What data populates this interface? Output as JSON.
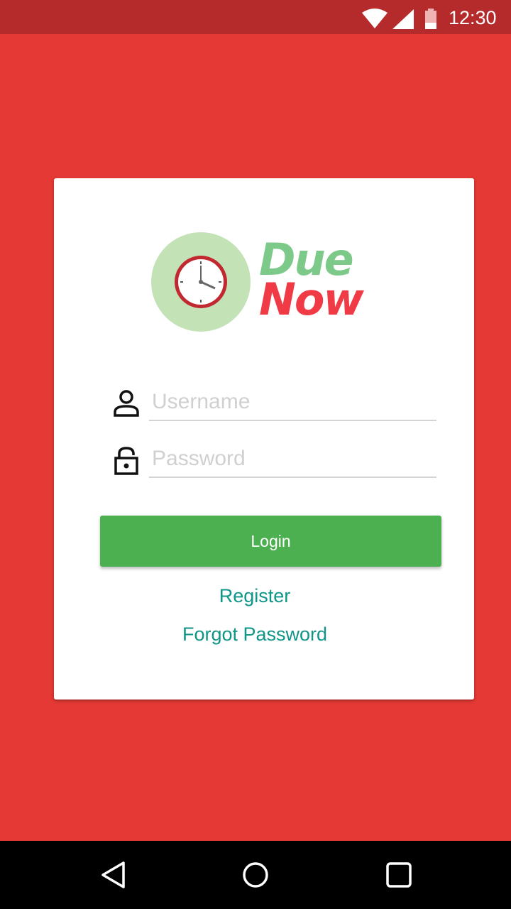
{
  "status_bar": {
    "time": "12:30",
    "icons": [
      "wifi-icon",
      "cell-signal-icon",
      "battery-low-icon"
    ]
  },
  "logo": {
    "line1": "Due",
    "line2": "Now",
    "icon": "clock-icon"
  },
  "form": {
    "username": {
      "placeholder": "Username",
      "value": "",
      "icon": "person-icon"
    },
    "password": {
      "placeholder": "Password",
      "value": "",
      "icon": "unlock-icon"
    },
    "login_label": "Login",
    "register_label": "Register",
    "forgot_label": "Forgot Password"
  },
  "nav_bar": {
    "icons": [
      "back-triangle-icon",
      "home-circle-icon",
      "recents-square-icon"
    ]
  },
  "colors": {
    "background": "#e53935",
    "status_bar": "#b52b2b",
    "login_button": "#4caf50",
    "link": "#0f9688",
    "logo_due": "#7cc98a",
    "logo_now": "#f03a45",
    "logo_circle": "#c3e2b6"
  }
}
